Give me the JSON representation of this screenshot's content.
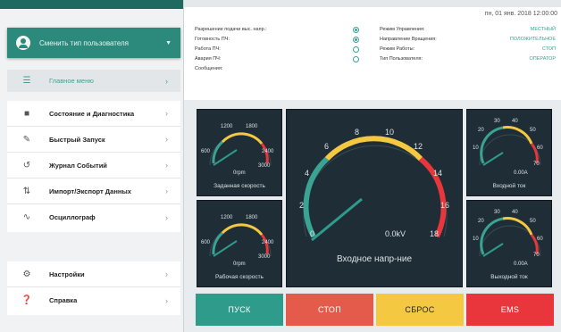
{
  "sidebar": {
    "user_button": "Сменить тип пользователя",
    "main_menu": "Главное меню",
    "items": [
      {
        "label": "Состояние и Диагностика",
        "icon": "monitor-icon"
      },
      {
        "label": "Быстрый Запуск",
        "icon": "edit-icon"
      },
      {
        "label": "Журнал Событий",
        "icon": "history-icon"
      },
      {
        "label": "Импорт/Экспорт Данных",
        "icon": "import-export-icon"
      },
      {
        "label": "Осциллограф",
        "icon": "oscilloscope-icon"
      }
    ],
    "bottom_items": [
      {
        "label": "Настройки",
        "icon": "gear-icon"
      },
      {
        "label": "Справка",
        "icon": "help-icon"
      }
    ]
  },
  "header": {
    "datetime": "пн, 01 янв. 2018 12:00:00"
  },
  "status_left": [
    {
      "label": "Разрешение подачи выс. напр.:",
      "on": true
    },
    {
      "label": "Готовность ПЧ:",
      "on": true
    },
    {
      "label": "Работа ПЧ:",
      "on": false
    },
    {
      "label": "Авария ПЧ:",
      "on": false
    },
    {
      "label": "Сообщения:",
      "on": null
    }
  ],
  "status_right": [
    {
      "label": "Режим Управления:",
      "value": "МЕСТНЫЙ"
    },
    {
      "label": "Направление Вращения:",
      "value": "ПОЛОЖИТЕЛЬНОЕ"
    },
    {
      "label": "Режим Работы:",
      "value": "СТОП"
    },
    {
      "label": "Тип Пользователя:",
      "value": "ОПЕРАТОР"
    }
  ],
  "gauges": {
    "set_speed": {
      "label": "Заданная скорость",
      "unit": "0rpm",
      "ticks": [
        "600",
        "1200",
        "1800",
        "2400",
        "3000"
      ]
    },
    "work_speed": {
      "label": "Рабочая скорость",
      "unit": "0rpm",
      "ticks": [
        "600",
        "1200",
        "1800",
        "2400",
        "3000"
      ]
    },
    "input_voltage": {
      "label": "Входное напр-ние",
      "value": "0.0kV",
      "ticks": [
        "0",
        "2",
        "4",
        "6",
        "8",
        "10",
        "12",
        "14",
        "16",
        "18"
      ]
    },
    "input_current": {
      "label": "Входной ток",
      "value": "0.00A",
      "ticks": [
        "10",
        "20",
        "30",
        "40",
        "50",
        "60",
        "70"
      ]
    },
    "output_current": {
      "label": "Выходной ток",
      "value": "0.00A",
      "ticks": [
        "10",
        "20",
        "30",
        "40",
        "50",
        "60",
        "70"
      ]
    }
  },
  "buttons": {
    "start": "ПУСК",
    "stop": "СТОП",
    "reset": "СБРОС",
    "ems": "EMS"
  },
  "colors": {
    "accent": "#2b8a7c",
    "start": "#2e9b8b",
    "stop": "#e45a4b",
    "reset": "#f5c842",
    "ems": "#e8363c"
  }
}
